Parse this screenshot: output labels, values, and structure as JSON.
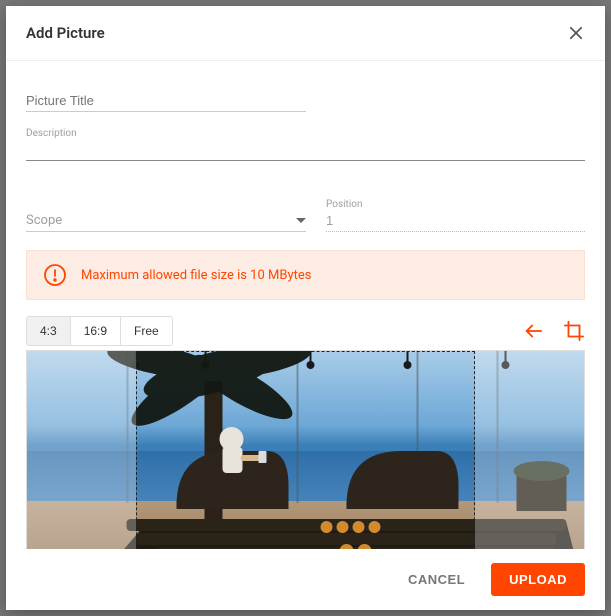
{
  "dialog": {
    "title": "Add Picture"
  },
  "fields": {
    "picture_title": {
      "label": "Picture Title",
      "value": ""
    },
    "description": {
      "label": "Description",
      "value": ""
    },
    "scope": {
      "label": "Scope",
      "value": ""
    },
    "position": {
      "label": "Position",
      "value": "1"
    }
  },
  "alert": {
    "message": "Maximum allowed file size is 10 MBytes"
  },
  "crop": {
    "ratios": [
      "4:3",
      "16:9",
      "Free"
    ],
    "active_index": 0
  },
  "footer": {
    "cancel": "CANCEL",
    "upload": "UPLOAD"
  },
  "colors": {
    "accent": "#ff4500"
  }
}
